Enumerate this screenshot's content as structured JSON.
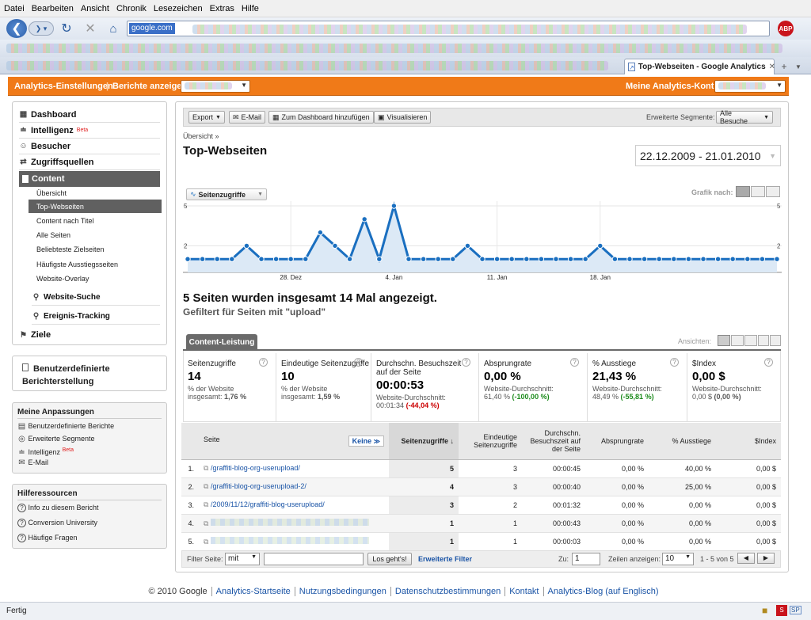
{
  "browser": {
    "menu": [
      "Datei",
      "Bearbeiten",
      "Ansicht",
      "Chronik",
      "Lesezeichen",
      "Extras",
      "Hilfe"
    ],
    "address": "google.com",
    "tab_title": "Top-Webseiten - Google Analytics",
    "abp": "ABP",
    "status": "Fertig",
    "status_badge": "SP"
  },
  "orangebar": {
    "settings": "Analytics-Einstellungen",
    "reports": "Berichte anzeigen:",
    "accounts": "Meine Analytics-Konten:"
  },
  "sidebar": {
    "dashboard": "Dashboard",
    "intelligence": "Intelligenz",
    "beta": "Beta",
    "visitors": "Besucher",
    "traffic": "Zugriffsquellen",
    "content": "Content",
    "sub": [
      "Übersicht",
      "Top-Webseiten",
      "Content nach Titel",
      "Alle Seiten",
      "Beliebteste Zielseiten",
      "Häufigste Ausstiegsseiten",
      "Website-Overlay"
    ],
    "site_search": "Website-Suche",
    "events": "Ereignis-Tracking",
    "goals": "Ziele",
    "custom_reports": "Benutzerdefinierte Berichterstellung",
    "my_custom": "Meine Anpassungen",
    "custom_items": [
      "Benutzerdefinierte Berichte",
      "Erweiterte Segmente",
      "Intelligenz",
      "E-Mail"
    ],
    "help_title": "Hilferessourcen",
    "help_items": [
      "Info zu diesem Bericht",
      "Conversion University",
      "Häufige Fragen"
    ]
  },
  "toolbar": {
    "export": "Export",
    "email": "E-Mail",
    "dashboard": "Zum Dashboard hinzufügen",
    "visualize": "Visualisieren",
    "segments_label": "Erweiterte Segmente:",
    "segments_value": "Alle Besuche"
  },
  "report": {
    "breadcrumb": "Übersicht »",
    "title": "Top-Webseiten",
    "daterange": "22.12.2009 - 21.01.2010",
    "graph_metric": "Seitenzugriffe",
    "graph_by": "Grafik nach:",
    "summary": "5 Seiten wurden insgesamt 14 Mal angezeigt.",
    "filter_note": "Gefiltert für Seiten mit \"upload\"",
    "tab": "Content-Leistung",
    "views_label": "Ansichten:"
  },
  "chart_data": {
    "type": "area",
    "series": [
      {
        "name": "Seitenzugriffe",
        "values": [
          1,
          1,
          1,
          1,
          2,
          1,
          1,
          1,
          1,
          3,
          2,
          1,
          4,
          1,
          5,
          1,
          1,
          1,
          1,
          2,
          1,
          1,
          1,
          1,
          1,
          1,
          1,
          1,
          2,
          1,
          1,
          1,
          1,
          1,
          1,
          1,
          1,
          1,
          1,
          1,
          1
        ]
      }
    ],
    "xticks": [
      {
        "index": 7,
        "label": "28. Dez"
      },
      {
        "index": 14,
        "label": "4. Jan"
      },
      {
        "index": 21,
        "label": "11. Jan"
      },
      {
        "index": 28,
        "label": "18. Jan"
      }
    ],
    "yticks": [
      2,
      5
    ],
    "ylim": [
      0,
      5
    ],
    "color": "#1a6fc0",
    "fill": "#dce9f6"
  },
  "metrics": [
    {
      "label": "Seitenzugriffe",
      "value": "14",
      "sub1": "% der Website",
      "sub2": "insgesamt:",
      "sub3": "1,76 %",
      "extra": ""
    },
    {
      "label": "Eindeutige Seitenzugriffe",
      "value": "10",
      "sub1": "% der Website",
      "sub2": "insgesamt:",
      "sub3": "1,59 %",
      "extra": ""
    },
    {
      "label": "Durchschn. Besuchszeit auf der Seite",
      "value": "00:00:53",
      "sub1": "Website-Durchschnitt:",
      "sub2": "00:01:34",
      "sub3": "(-44,04 %)",
      "extra": "neg"
    },
    {
      "label": "Absprungrate",
      "value": "0,00 %",
      "sub1": "Website-Durchschnitt:",
      "sub2": "61,40 %",
      "sub3": "(-100,00 %)",
      "extra": "pos"
    },
    {
      "label": "% Ausstiege",
      "value": "21,43 %",
      "sub1": "Website-Durchschnitt:",
      "sub2": "48,49 %",
      "sub3": "(-55,81 %)",
      "extra": "pos"
    },
    {
      "label": "$Index",
      "value": "0,00 $",
      "sub1": "Website-Durchschnitt:",
      "sub2": "0,00 $",
      "sub3": "(0,00 %)",
      "extra": ""
    }
  ],
  "table": {
    "page_header": "Seite",
    "secondary": "Keine",
    "headers": [
      "Seitenzugriffe",
      "Eindeutige Seitenzugriffe",
      "Durchschn. Besuchszeit auf der Seite",
      "Absprungrate",
      "% Ausstiege",
      "$Index"
    ],
    "rows": [
      {
        "n": "1.",
        "page": "/graffiti-blog-org-userupload/",
        "cells": [
          "5",
          "3",
          "00:00:45",
          "0,00 %",
          "40,00 %",
          "0,00 $"
        ]
      },
      {
        "n": "2.",
        "page": "/graffiti-blog-org-userupload-2/",
        "cells": [
          "4",
          "3",
          "00:00:40",
          "0,00 %",
          "25,00 %",
          "0,00 $"
        ]
      },
      {
        "n": "3.",
        "page": "/2009/11/12/graffiti-blog-userupload/",
        "cells": [
          "3",
          "2",
          "00:01:32",
          "0,00 %",
          "0,00 %",
          "0,00 $"
        ]
      },
      {
        "n": "4.",
        "page": "",
        "cells": [
          "1",
          "1",
          "00:00:43",
          "0,00 %",
          "0,00 %",
          "0,00 $"
        ]
      },
      {
        "n": "5.",
        "page": "",
        "cells": [
          "1",
          "1",
          "00:00:03",
          "0,00 %",
          "0,00 %",
          "0,00 $"
        ]
      }
    ]
  },
  "pager": {
    "filter_label": "Filter Seite:",
    "filter_mode": "mit",
    "go": "Los geht's!",
    "advanced": "Erweiterte Filter",
    "goto_label": "Zu:",
    "goto_value": "1",
    "rows_label": "Zeilen anzeigen:",
    "rows_value": "10",
    "range": "1 - 5 von 5"
  },
  "footer": {
    "copyright": "© 2010 Google",
    "links": [
      "Analytics-Startseite",
      "Nutzungsbedingungen",
      "Datenschutzbestimmungen",
      "Kontakt",
      "Analytics-Blog (auf Englisch)"
    ]
  }
}
